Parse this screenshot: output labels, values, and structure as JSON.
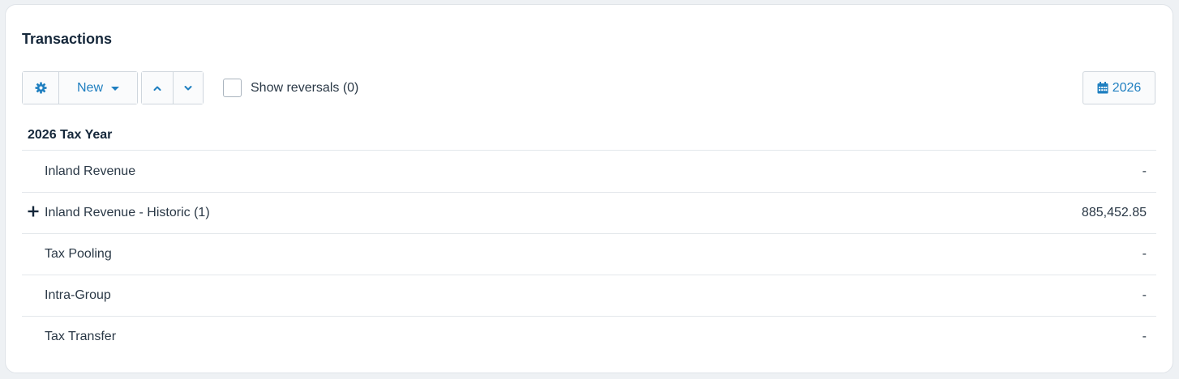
{
  "panel": {
    "title": "Transactions"
  },
  "toolbar": {
    "settings_icon": "gear-icon",
    "new_label": "New",
    "new_caret_icon": "caret-down-icon",
    "move_up_icon": "chevron-up-icon",
    "move_down_icon": "chevron-down-icon",
    "show_reversals_label": "Show reversals (0)",
    "show_reversals_checked": false,
    "year_icon": "calendar-icon",
    "year_label": "2026"
  },
  "section": {
    "title": "2026 Tax Year"
  },
  "rows": [
    {
      "label": "Inland Revenue",
      "amount": "-",
      "expandable": false
    },
    {
      "label": "Inland Revenue - Historic (1)",
      "amount": "885,452.85",
      "expandable": true,
      "expander_icon": "plus-icon"
    },
    {
      "label": "Tax Pooling",
      "amount": "-",
      "expandable": false
    },
    {
      "label": "Intra-Group",
      "amount": "-",
      "expandable": false
    },
    {
      "label": "Tax Transfer",
      "amount": "-",
      "expandable": false
    }
  ],
  "colors": {
    "accent": "#1f7fc0",
    "text": "#2a3846",
    "heading": "#15273a",
    "border": "#cfd6dd"
  }
}
